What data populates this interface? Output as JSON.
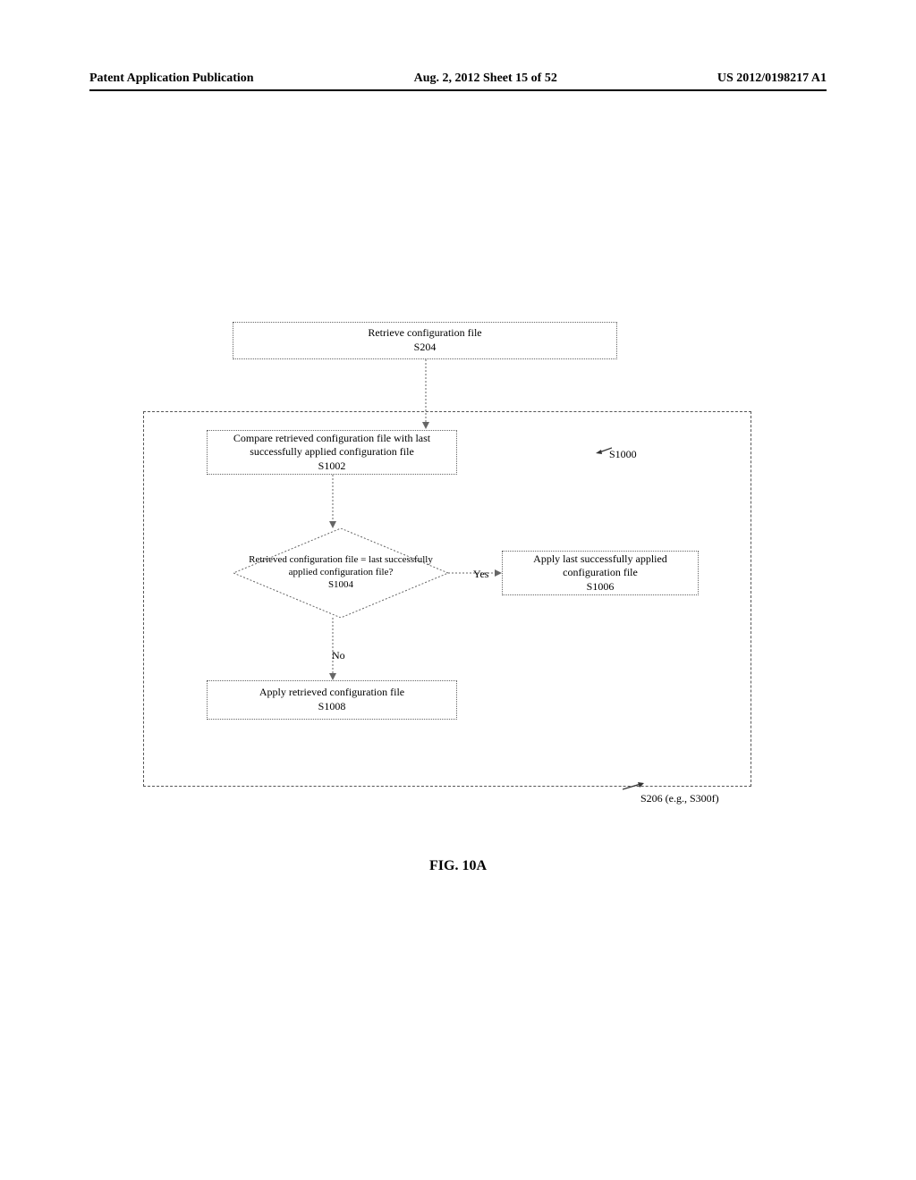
{
  "header": {
    "left": "Patent Application Publication",
    "center": "Aug. 2, 2012  Sheet 15 of 52",
    "right": "US 2012/0198217 A1"
  },
  "figure_label": "FIG. 10A",
  "boxes": {
    "retrieve": {
      "text": "Retrieve configuration file",
      "ref": "S204"
    },
    "compare": {
      "text": "Compare retrieved configuration file with last successfully applied configuration file",
      "ref": "S1002"
    },
    "decision": {
      "text": "Retrieved configuration file = last successfully applied configuration file?",
      "ref": "S1004"
    },
    "apply_last": {
      "text": "Apply last successfully applied configuration file",
      "ref": "S1006"
    },
    "apply_retrieved": {
      "text": "Apply retrieved configuration file",
      "ref": "S1008"
    }
  },
  "labels": {
    "yes": "Yes",
    "no": "No",
    "callout": "S1000",
    "container_ref": "S206 (e.g., S300f)"
  }
}
